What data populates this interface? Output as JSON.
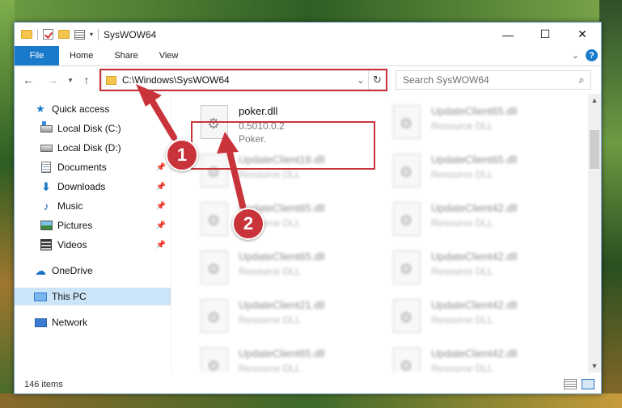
{
  "window": {
    "title": "SysWOW64"
  },
  "ribbon": {
    "tabs": [
      "File",
      "Home",
      "Share",
      "View"
    ],
    "help_label": "?"
  },
  "address": {
    "path": "C:\\Windows\\SysWOW64"
  },
  "search": {
    "placeholder": "Search SysWOW64"
  },
  "sidebar": {
    "items": [
      {
        "label": "Quick access",
        "icon": "star-icon"
      },
      {
        "label": "Local Disk (C:)",
        "icon": "disk-icon"
      },
      {
        "label": "Local Disk (D:)",
        "icon": "disk-icon"
      },
      {
        "label": "Documents",
        "icon": "documents-icon"
      },
      {
        "label": "Downloads",
        "icon": "downloads-icon"
      },
      {
        "label": "Music",
        "icon": "music-icon"
      },
      {
        "label": "Pictures",
        "icon": "pictures-icon"
      },
      {
        "label": "Videos",
        "icon": "videos-icon"
      },
      {
        "label": "OneDrive",
        "icon": "cloud-icon"
      },
      {
        "label": "This PC",
        "icon": "pc-icon"
      },
      {
        "label": "Network",
        "icon": "network-icon"
      }
    ],
    "selected": "This PC"
  },
  "files": [
    {
      "name": "poker.dll",
      "version": "0.5010.0.2",
      "description": "Poker."
    },
    {
      "name": "UpdateClient65.dll",
      "description": "Resource DLL"
    },
    {
      "name": "UpdateClient19.dll",
      "description": "Resource DLL"
    },
    {
      "name": "UpdateClient65.dll",
      "description": "Resource DLL"
    },
    {
      "name": "UpdateClient65.dll",
      "description": "Resource DLL"
    },
    {
      "name": "UpdateClient42.dll",
      "description": "Resource DLL"
    },
    {
      "name": "UpdateClient65.dll",
      "description": "Resource DLL"
    },
    {
      "name": "UpdateClient42.dll",
      "description": "Resource DLL"
    },
    {
      "name": "UpdateClient21.dll",
      "description": "Resource DLL"
    },
    {
      "name": "UpdateClient42.dll",
      "description": "Resource DLL"
    },
    {
      "name": "UpdateClient65.dll",
      "description": "Resource DLL"
    },
    {
      "name": "UpdateClient42.dll",
      "description": "Resource DLL"
    }
  ],
  "status": {
    "item_count": "146 items"
  },
  "annotations": {
    "marker1": "1",
    "marker2": "2",
    "color": "#c9343b"
  },
  "colors": {
    "accent": "#1979ca",
    "selected_bg": "#cce4f7"
  }
}
